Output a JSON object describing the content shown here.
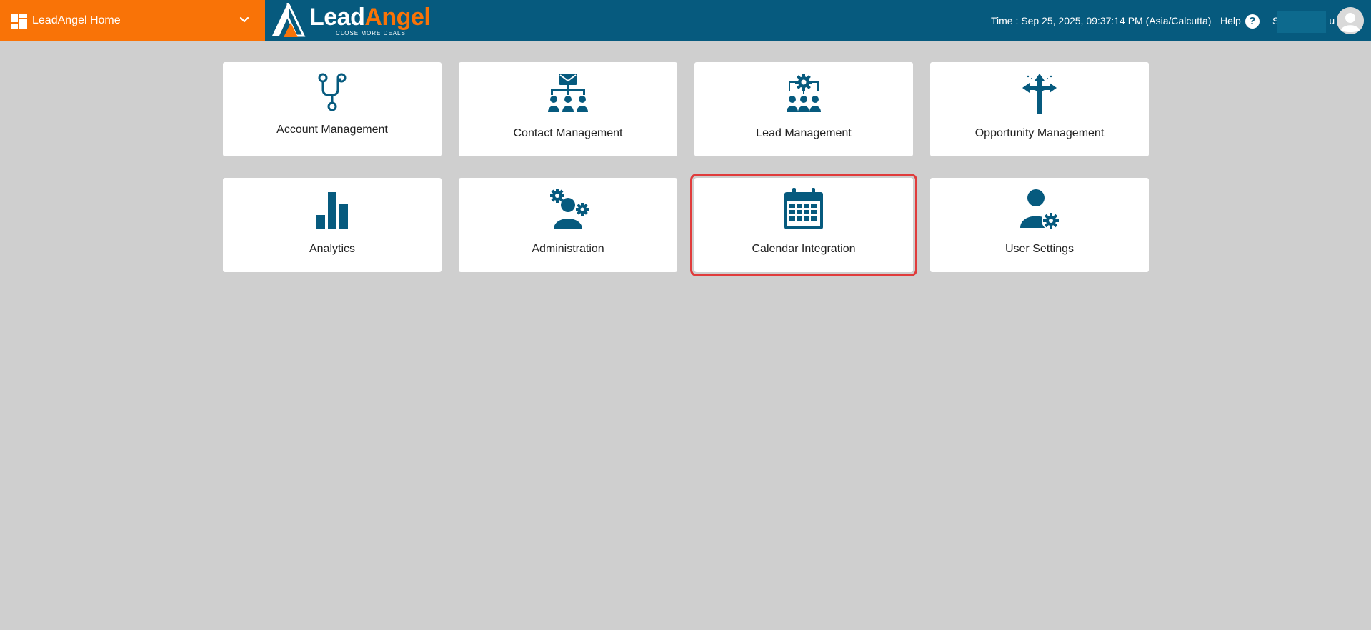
{
  "header": {
    "app_switcher_label": "LeadAngel Home",
    "logo_word_1": "Lead",
    "logo_word_2": "Angel",
    "logo_tagline": "CLOSE MORE DEALS",
    "time_text": "Time : Sep 25, 2025, 09:37:14 PM (Asia/Calcutta)",
    "help_label": "Help",
    "help_glyph": "?",
    "user_name_start": "S",
    "user_name_end": "u"
  },
  "tiles": [
    {
      "label": "Account Management",
      "icon": "branch-icon"
    },
    {
      "label": "Contact Management",
      "icon": "email-hierarchy-icon"
    },
    {
      "label": "Lead Management",
      "icon": "team-gear-icon"
    },
    {
      "label": "Opportunity Management",
      "icon": "split-arrows-icon"
    },
    {
      "label": "Analytics",
      "icon": "bar-chart-icon"
    },
    {
      "label": "Administration",
      "icon": "admin-gears-icon"
    },
    {
      "label": "Calendar Integration",
      "icon": "calendar-icon"
    },
    {
      "label": "User Settings",
      "icon": "user-gear-icon"
    }
  ],
  "colors": {
    "header_bg": "#065a7e",
    "accent_orange": "#f97307",
    "icon_blue": "#065a7e",
    "page_bg": "#cfcfcf",
    "highlight_red": "#e03c3c"
  }
}
